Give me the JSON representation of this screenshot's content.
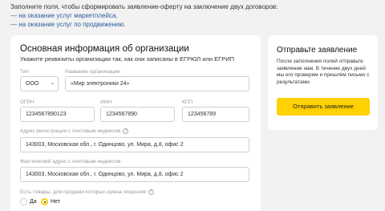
{
  "intro": {
    "text": "Заполните поля, чтобы сформировать заявление-оферту на заключение двух договоров:",
    "links": [
      "— на оказание услуг маркетплейса,",
      "— на оказание услуг по продвижению."
    ]
  },
  "form": {
    "title": "Основная информация об организации",
    "subtitle": "Укажите реквизиты организации так, как они записаны в ЕГРЮЛ или ЕГРИП",
    "type_label": "Тип",
    "type_value": "ООО",
    "name_label": "Название организации",
    "name_value": "«Мир электроники 24»",
    "ogrn_label": "ОГРН",
    "ogrn_value": "1234567890123",
    "inn_label": "ИНН",
    "inn_value": "1234567890",
    "kpp_label": "КПП",
    "kpp_value": "123456789",
    "reg_addr_label": "Адрес регистрации с почтовым индексом",
    "reg_addr_value": "143003, Московская обл., г. Одинцово, ул. Мира, д.8, офис 2",
    "fact_addr_label": "Фактический адрес с почтовым индексом",
    "fact_addr_value": "143003, Московская обл., г. Одинцово, ул. Мира, д.8, офис 2",
    "license_label": "Есть товары, для продажи которых нужна лицензия",
    "option_yes": "Да",
    "option_no": "Нет",
    "selected": "Нет"
  },
  "side": {
    "title": "Отправьте заявление",
    "text": "После заполнения полей отправьте заявление нам. В течение двух дней мы его проверим и пришлём письмо с результатами.",
    "button": "Отправить заявление"
  },
  "colors": {
    "accent": "#ffd100",
    "link": "#2a5d9f",
    "background": "#f2f2f2"
  }
}
